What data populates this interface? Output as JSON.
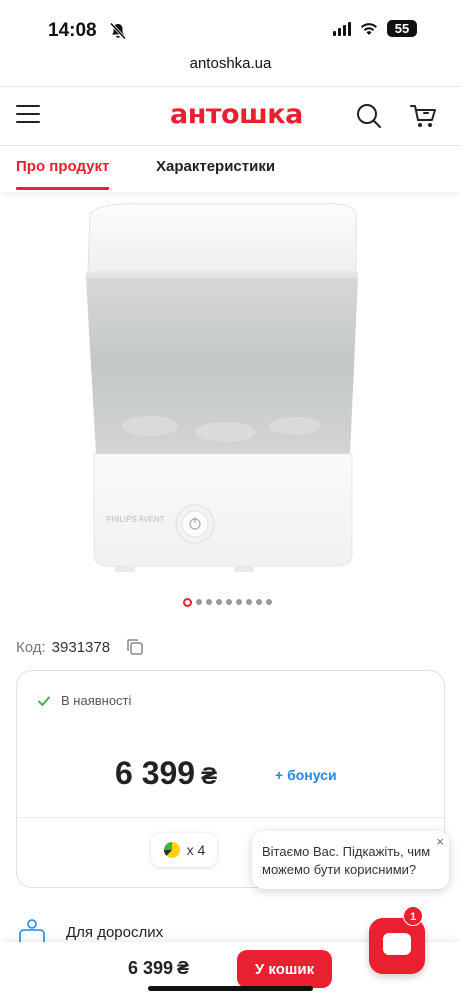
{
  "status_bar": {
    "time": "14:08",
    "battery": "55"
  },
  "browser": {
    "url": "antoshka.ua"
  },
  "header": {
    "logo_text": "антошка"
  },
  "tabs": [
    {
      "label": "Про продукт",
      "active": true
    },
    {
      "label": "Характеристики",
      "active": false
    }
  ],
  "product": {
    "brand_text": "PHILIPS AVENT",
    "image_count": 9,
    "active_image": 1,
    "code_label": "Код:",
    "code": "3931378",
    "stock_status": "В наявності",
    "price": "6 399",
    "currency": "₴",
    "bonus_label": "+ бонуси",
    "installments": "x 4",
    "category": "Для дорослих"
  },
  "chat": {
    "greeting": "Вітаємо Вас. Підкажіть, чим можемо бути корисними?",
    "close_icon": "×",
    "unread_count": "1"
  },
  "bottom_bar": {
    "price": "6 399",
    "currency": "₴",
    "add_to_cart": "У кошик"
  },
  "colors": {
    "brand_red": "#e8202f",
    "bonus_blue": "#1e88e5",
    "stock_green": "#4caf50"
  }
}
